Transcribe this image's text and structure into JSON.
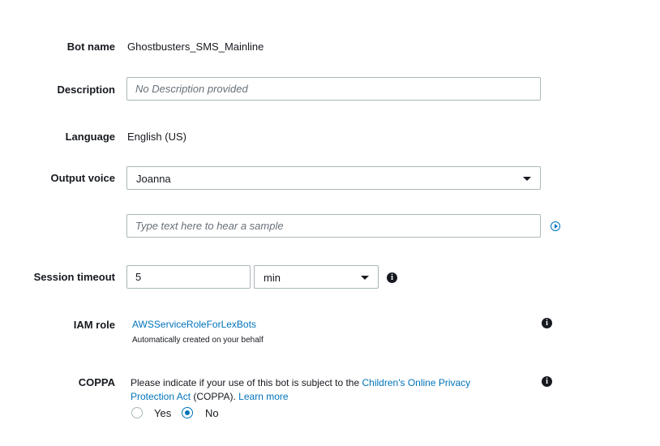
{
  "bot_name": {
    "label": "Bot name",
    "value": "Ghostbusters_SMS_Mainline"
  },
  "description": {
    "label": "Description",
    "value": "",
    "placeholder": "No Description provided"
  },
  "language": {
    "label": "Language",
    "value": "English (US)"
  },
  "output_voice": {
    "label": "Output voice",
    "selected": "Joanna",
    "sample_value": "",
    "sample_placeholder": "Type text here to hear a sample",
    "play_icon": "play-circle-icon"
  },
  "session_timeout": {
    "label": "Session timeout",
    "value": "5",
    "unit_selected": "min",
    "info_icon": "info-icon"
  },
  "iam_role": {
    "label": "IAM role",
    "link": "AWSServiceRoleForLexBots",
    "note": "Automatically created on your behalf",
    "info_icon": "info-icon"
  },
  "coppa": {
    "label": "COPPA",
    "text_before": "Please indicate if your use of this bot is subject to the ",
    "link_line1": "Children's Online Privacy",
    "link_line2": "Protection Act",
    "text_after": " (COPPA). ",
    "learn_more": "Learn more",
    "options": [
      {
        "label": "Yes",
        "selected": false
      },
      {
        "label": "No",
        "selected": true
      }
    ],
    "info_icon": "info-icon"
  },
  "colors": {
    "link": "#0073bb",
    "border": "#aab7b8",
    "text": "#16191f",
    "placeholder": "#687078"
  }
}
